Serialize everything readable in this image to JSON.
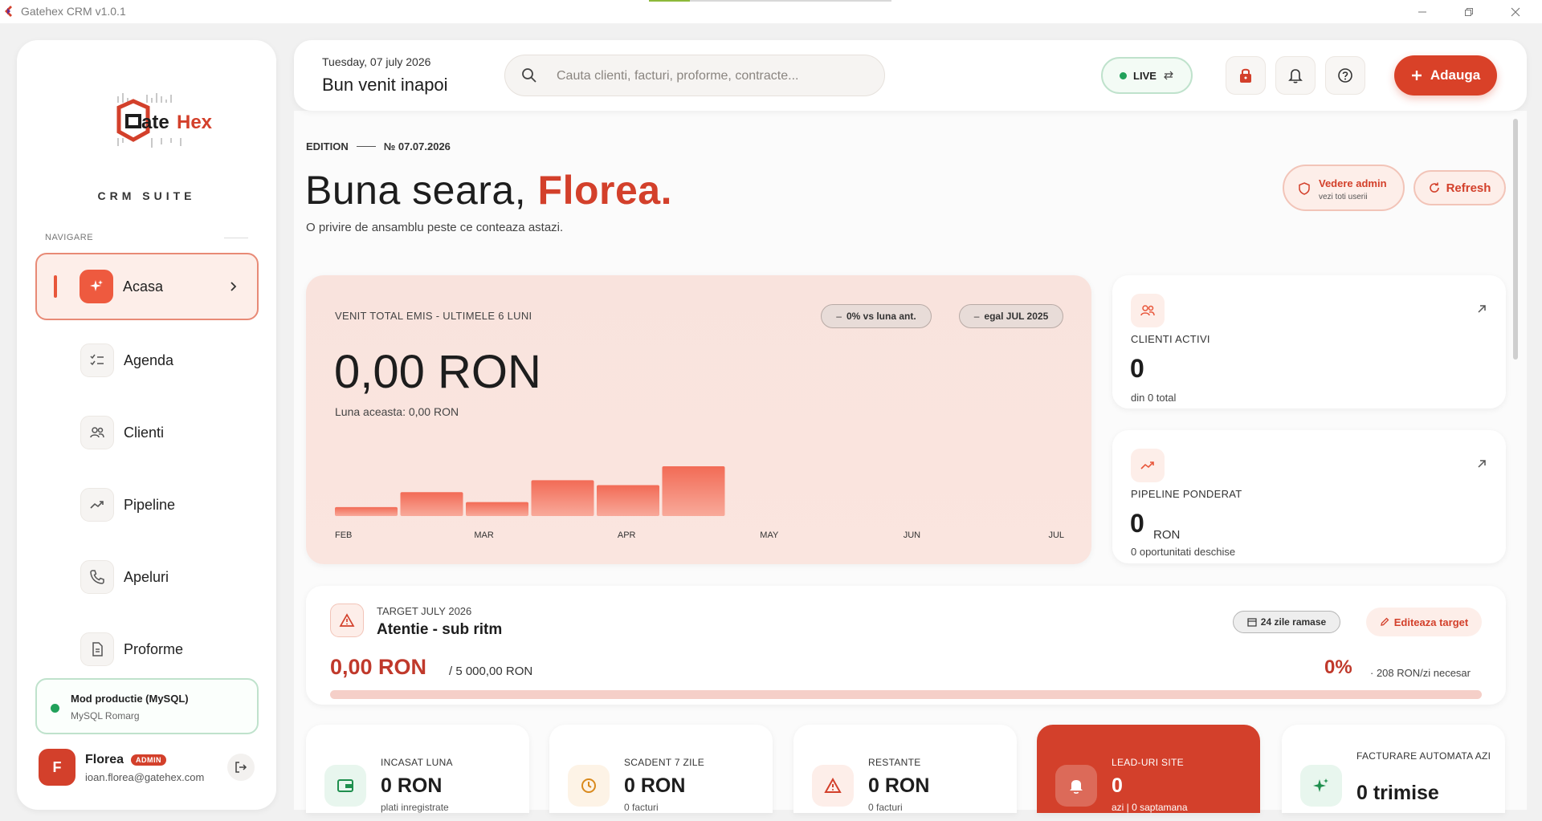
{
  "window": {
    "title": "Gatehex CRM v1.0.1",
    "load_progress_pct": 17
  },
  "sidebar": {
    "suite_label": "CRM SUITE",
    "nav_header": "NAVIGARE",
    "items": [
      {
        "label": "Acasa",
        "icon": "sparkle-icon",
        "active": true
      },
      {
        "label": "Agenda",
        "icon": "checklist-icon"
      },
      {
        "label": "Clienti",
        "icon": "users-icon"
      },
      {
        "label": "Pipeline",
        "icon": "trend-icon"
      },
      {
        "label": "Apeluri",
        "icon": "phone-icon"
      },
      {
        "label": "Proforme",
        "icon": "document-icon"
      }
    ],
    "mode": {
      "title": "Mod productie (MySQL)",
      "subtitle": "MySQL Romarg"
    },
    "user": {
      "initial": "F",
      "name": "Florea",
      "role": "ADMIN",
      "email": "ioan.florea@gatehex.com"
    }
  },
  "header": {
    "date": "Tuesday, 07 july 2026",
    "welcome": "Bun venit inapoi",
    "search_placeholder": "Cauta clienti, facturi, proforme, contracte...",
    "live_label": "LIVE",
    "add_label": "Adauga"
  },
  "hero": {
    "edition_label": "EDITION",
    "edition_number": "№ 07.07.2026",
    "greeting": "Buna seara,",
    "name": "Florea.",
    "subtitle": "O privire de ansamblu peste ce conteaza astazi.",
    "admin_view_title": "Vedere admin",
    "admin_view_sub": "vezi toti userii",
    "refresh_label": "Refresh"
  },
  "revenue": {
    "label": "VENIT TOTAL EMIS - ULTIMELE 6 LUNI",
    "pill_vs": "0% vs luna ant.",
    "pill_eq": "egal JUL 2025",
    "amount": "0,00 RON",
    "this_month": "Luna aceasta: 0,00 RON"
  },
  "chart_data": {
    "type": "bar",
    "categories": [
      "FEB",
      "MAR",
      "APR",
      "MAY",
      "JUN",
      "JUL"
    ],
    "series": [
      {
        "values": [
          0.18,
          0.48,
          0.28,
          0.72,
          0.62,
          1.0,
          0,
          0,
          0,
          0,
          0
        ]
      }
    ],
    "bar_slots": 11,
    "ylim": [
      0,
      1
    ],
    "grid": false
  },
  "stats": {
    "clients": {
      "label": "CLIENTI ACTIVI",
      "value": "0",
      "sub": "din 0 total"
    },
    "pipeline": {
      "label": "PIPELINE PONDERAT",
      "value": "0",
      "unit": "RON",
      "sub": "0 oportunitati deschise"
    }
  },
  "target": {
    "label": "TARGET JULY 2026",
    "status": "Atentie - sub ritm",
    "days_left": "24 zile ramase",
    "edit_label": "Editeaza target",
    "amount": "0,00 RON",
    "of_total": "/ 5 000,00 RON",
    "percent": "0%",
    "needed": "· 208 RON/zi necesar",
    "progress_pct": 0
  },
  "kpis": [
    {
      "label": "INCASAT LUNA",
      "value": "0 RON",
      "sub": "plati inregistrate",
      "icon": "wallet-icon"
    },
    {
      "label": "SCADENT 7 ZILE",
      "value": "0 RON",
      "sub": "0 facturi",
      "icon": "clock-icon"
    },
    {
      "label": "RESTANTE",
      "value": "0 RON",
      "sub": "0 facturi",
      "icon": "warning-icon"
    },
    {
      "label": "LEAD-URI SITE",
      "value": "0",
      "sub": "azi  |  0 saptamana",
      "icon": "bell-icon"
    },
    {
      "label": "FACTURARE AUTOMATA AZI",
      "value": "0 trimise",
      "sub": "",
      "icon": "sparkle-icon"
    }
  ],
  "colors": {
    "accent": "#d3402b",
    "accent_light": "#fdeee9",
    "success": "#21a15a",
    "bar_top": "#f26b56",
    "bar_bottom": "#f8a99a"
  }
}
